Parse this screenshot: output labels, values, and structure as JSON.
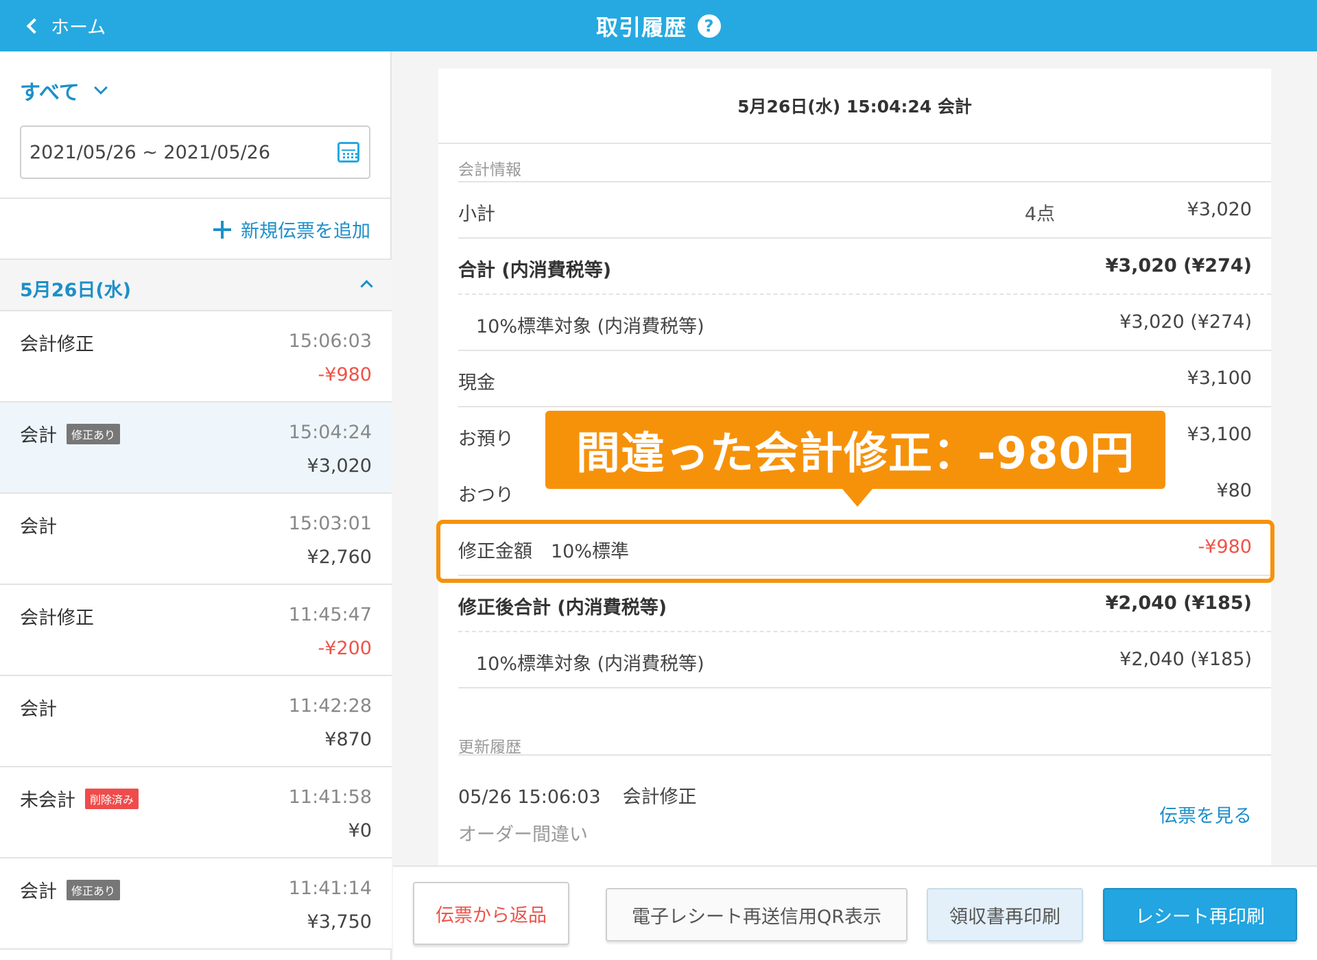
{
  "header": {
    "back_label": "ホーム",
    "title": "取引履歴",
    "help_glyph": "?"
  },
  "sidebar": {
    "filter_label": "すべて",
    "date_range": "2021/05/26 ~ 2021/05/26",
    "add_label": "新規伝票を追加",
    "day_label": "5月26日(水)",
    "transactions": [
      {
        "name": "会計修正",
        "badge": "",
        "time": "15:06:03",
        "amount": "-¥980"
      },
      {
        "name": "会計",
        "badge": "修正あり",
        "time": "15:04:24",
        "amount": "¥3,020"
      },
      {
        "name": "会計",
        "badge": "",
        "time": "15:03:01",
        "amount": "¥2,760"
      },
      {
        "name": "会計修正",
        "badge": "",
        "time": "11:45:47",
        "amount": "-¥200"
      },
      {
        "name": "会計",
        "badge": "",
        "time": "11:42:28",
        "amount": "¥870"
      },
      {
        "name": "未会計",
        "badge": "削除済み",
        "time": "11:41:58",
        "amount": "¥0"
      },
      {
        "name": "会計",
        "badge": "修正あり",
        "time": "11:41:14",
        "amount": "¥3,750"
      }
    ]
  },
  "detail": {
    "title": "5月26日(水) 15:04:24 会計",
    "section_info": "会計情報",
    "subtotal": {
      "label": "小計",
      "count": "4点",
      "value": "¥3,020"
    },
    "total": {
      "label": "合計 (内消費税等)",
      "value": "¥3,020 (¥274)"
    },
    "total_10": {
      "label": "10%標準対象 (内消費税等)",
      "value": "¥3,020 (¥274)"
    },
    "cash": {
      "label": "現金",
      "value": "¥3,100"
    },
    "received": {
      "label": "お預り",
      "value": "¥3,100"
    },
    "change": {
      "label": "おつり",
      "value": "¥80"
    },
    "correction": {
      "label": "修正金額　10%標準",
      "value": "-¥980"
    },
    "corrected_total": {
      "label": "修正後合計 (内消費税等)",
      "value": "¥2,040 (¥185)"
    },
    "corrected_10": {
      "label": "10%標準対象 (内消費税等)",
      "value": "¥2,040 (¥185)"
    },
    "section_history": "更新履歴",
    "history": {
      "datetime": "05/26 15:06:03",
      "type": "会計修正",
      "note": "オーダー間違い",
      "link": "伝票を見る"
    }
  },
  "callout": {
    "text": "間違った会計修正：-980円"
  },
  "toolbar": {
    "return_label": "伝票から返品",
    "qr_label": "電子レシート再送信用QR表示",
    "receipt_label": "領収書再印刷",
    "reprint_label": "レシート再印刷"
  },
  "colors": {
    "header": "#26a9e0",
    "accent": "#1d8fc9",
    "negative": "#ee5349",
    "callout": "#f6920a"
  }
}
